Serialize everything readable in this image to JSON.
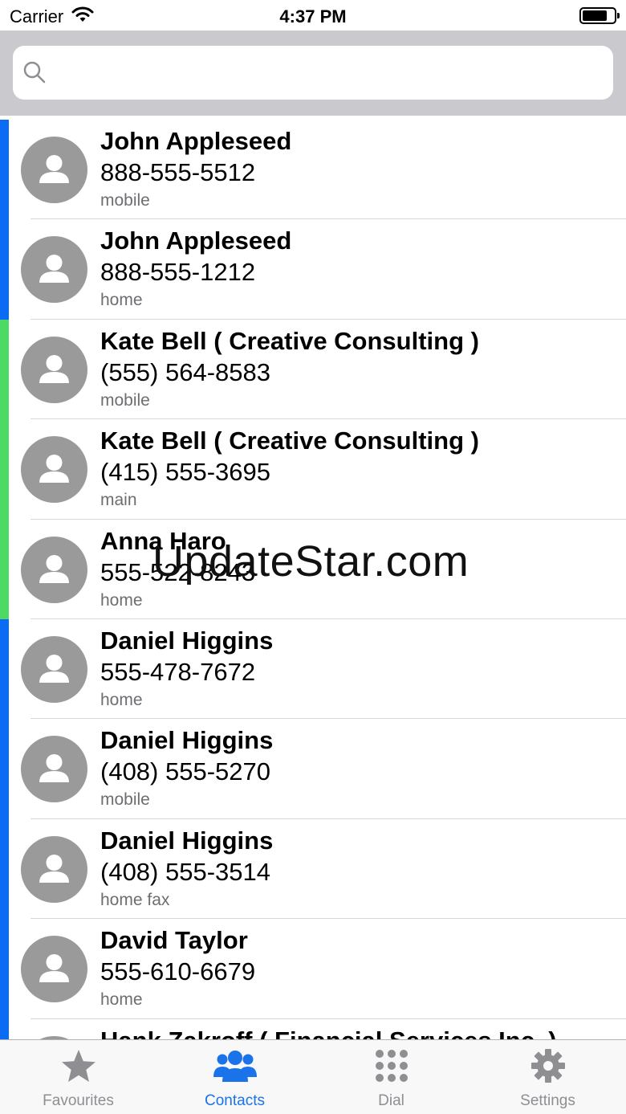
{
  "status_bar": {
    "carrier": "Carrier",
    "time": "4:37 PM"
  },
  "search": {
    "placeholder": "",
    "value": ""
  },
  "colors": {
    "accent": "#1a73e8",
    "stripe_blue": "#0a6cf5",
    "stripe_green": "#4cd964",
    "avatar": "#9a9a9a"
  },
  "contacts": [
    {
      "name": "John Appleseed",
      "phone": "888-555-5512",
      "label": "mobile",
      "stripe": "#0a6cf5"
    },
    {
      "name": "John Appleseed",
      "phone": "888-555-1212",
      "label": "home",
      "stripe": "#0a6cf5"
    },
    {
      "name": "Kate Bell ( Creative Consulting )",
      "phone": "(555) 564-8583",
      "label": "mobile",
      "stripe": "#4cd964"
    },
    {
      "name": "Kate Bell ( Creative Consulting )",
      "phone": "(415) 555-3695",
      "label": "main",
      "stripe": "#4cd964"
    },
    {
      "name": "Anna Haro",
      "phone": "555-522-8243",
      "label": "home",
      "stripe": "#4cd964"
    },
    {
      "name": "Daniel Higgins",
      "phone": "555-478-7672",
      "label": "home",
      "stripe": "#0a6cf5"
    },
    {
      "name": "Daniel Higgins",
      "phone": "(408) 555-5270",
      "label": "mobile",
      "stripe": "#0a6cf5"
    },
    {
      "name": "Daniel Higgins",
      "phone": "(408) 555-3514",
      "label": "home fax",
      "stripe": "#0a6cf5"
    },
    {
      "name": "David Taylor",
      "phone": "555-610-6679",
      "label": "home",
      "stripe": "#0a6cf5"
    },
    {
      "name": "Hank Zakroff ( Financial Services Inc. )",
      "phone": "",
      "label": "",
      "stripe": "#0a6cf5"
    }
  ],
  "watermark": "UpdateStar.com",
  "tabs": [
    {
      "label": "Favourites",
      "icon": "star-icon",
      "active": false
    },
    {
      "label": "Contacts",
      "icon": "contacts-icon",
      "active": true
    },
    {
      "label": "Dial",
      "icon": "dialpad-icon",
      "active": false
    },
    {
      "label": "Settings",
      "icon": "gear-icon",
      "active": false
    }
  ]
}
